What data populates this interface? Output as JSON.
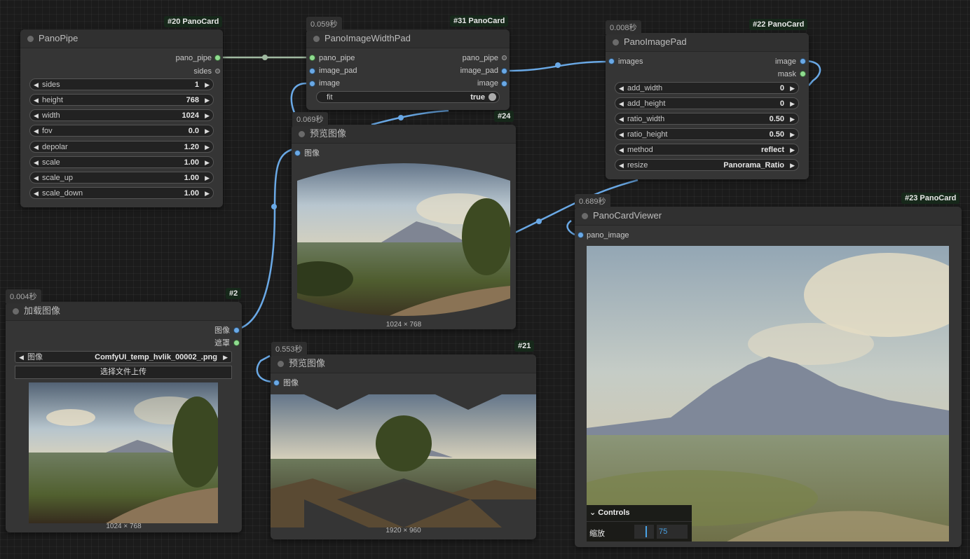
{
  "colors": {
    "wire_blue": "#6aa9e6",
    "wire_grey": "#9fb8a0",
    "badge_bg": "#16281a"
  },
  "nodes": {
    "pano_pipe": {
      "badge": "#20 PanoCard",
      "title": "PanoPipe",
      "outputs": [
        "pano_pipe",
        "sides"
      ],
      "widgets": [
        {
          "label": "sides",
          "value": "1"
        },
        {
          "label": "height",
          "value": "768"
        },
        {
          "label": "width",
          "value": "1024"
        },
        {
          "label": "fov",
          "value": "0.0"
        },
        {
          "label": "depolar",
          "value": "1.20"
        },
        {
          "label": "scale",
          "value": "1.00"
        },
        {
          "label": "scale_up",
          "value": "1.00"
        },
        {
          "label": "scale_down",
          "value": "1.00"
        }
      ]
    },
    "width_pad": {
      "timer": "0.059秒",
      "badge": "#31 PanoCard",
      "title": "PanoImageWidthPad",
      "inputs": [
        "pano_pipe",
        "image_pad",
        "image"
      ],
      "outputs": [
        "pano_pipe",
        "image_pad",
        "image"
      ],
      "fit_label": "fit",
      "fit_value": "true"
    },
    "image_pad": {
      "timer": "0.008秒",
      "badge": "#22 PanoCard",
      "title": "PanoImagePad",
      "input": "images",
      "outputs": [
        "image",
        "mask"
      ],
      "widgets": [
        {
          "label": "add_width",
          "value": "0"
        },
        {
          "label": "add_height",
          "value": "0"
        },
        {
          "label": "ratio_width",
          "value": "0.50"
        },
        {
          "label": "ratio_height",
          "value": "0.50"
        },
        {
          "label": "method",
          "value": "reflect"
        },
        {
          "label": "resize",
          "value": "Panorama_Ratio"
        }
      ]
    },
    "preview24": {
      "timer": "0.069秒",
      "badge": "#24",
      "title": "预览图像",
      "input": "图像",
      "caption": "1024 × 768"
    },
    "load_image": {
      "timer": "0.004秒",
      "badge": "#2",
      "title": "加载图像",
      "outputs": [
        "图像",
        "遮罩"
      ],
      "combo_label": "图像",
      "combo_value": "ComfyUI_temp_hvlik_00002_.png",
      "upload_label": "选择文件上传",
      "caption": "1024 × 768"
    },
    "preview21": {
      "timer": "0.553秒",
      "badge": "#21",
      "title": "预览图像",
      "input": "图像",
      "caption": "1920 × 960"
    },
    "viewer": {
      "timer": "0.689秒",
      "badge": "#23 PanoCard",
      "title": "PanoCardViewer",
      "input": "pano_image",
      "controls_label": "Controls",
      "zoom_label": "缩放",
      "zoom_value": "75"
    }
  }
}
